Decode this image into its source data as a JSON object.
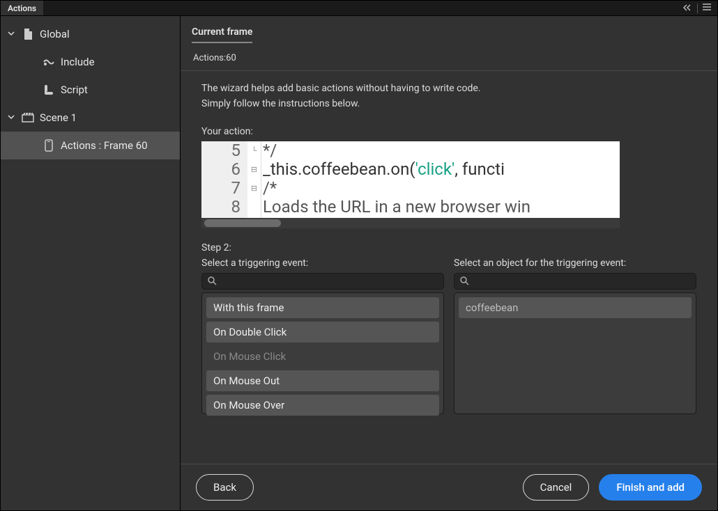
{
  "tabbar": {
    "title": "Actions"
  },
  "sidebar": {
    "items": [
      {
        "label": "Global",
        "icon": "document"
      },
      {
        "label": "Include",
        "icon": "include"
      },
      {
        "label": "Script",
        "icon": "script"
      },
      {
        "label": "Scene 1",
        "icon": "scene"
      },
      {
        "label": "Actions : Frame 60",
        "icon": "frame"
      }
    ]
  },
  "header": {
    "title": "Current frame",
    "subtitle": "Actions:60"
  },
  "intro": {
    "line1": "The wizard helps add basic actions without having to write code.",
    "line2": "Simply follow the instructions below."
  },
  "action_label": "Your action:",
  "code": {
    "line5": "*/",
    "line6a": "_this.coffeebean.on(",
    "line6b": "'click'",
    "line6c": ", functi",
    "line7": "/*",
    "line8": "Loads the URL in a new browser win",
    "n5": "5",
    "n6": "6",
    "n7": "7",
    "n8": "8"
  },
  "step2_label": "Step 2:",
  "left_col": {
    "heading": "Select a triggering event:",
    "items": [
      "With this frame",
      "On Double Click",
      "On Mouse Click",
      "On Mouse Out",
      "On Mouse Over"
    ]
  },
  "right_col": {
    "heading": "Select an object for the triggering event:",
    "items": [
      "coffeebean"
    ]
  },
  "footer": {
    "back": "Back",
    "cancel": "Cancel",
    "finish": "Finish and add"
  }
}
